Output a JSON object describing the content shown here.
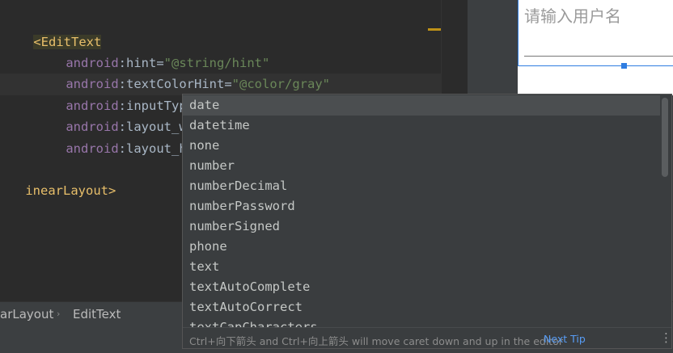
{
  "editor": {
    "lines": [
      {
        "tag": "<EditText"
      },
      {
        "ns": "android",
        "attr": "hint",
        "value": "\"@string/hint\""
      },
      {
        "ns": "android",
        "attr": "textColorHint",
        "value": "\"@color/gray\""
      },
      {
        "ns": "android",
        "attr": "inputType",
        "value_open": "\"",
        "value_close": "\""
      },
      {
        "ns": "android",
        "attr": "layout_wid"
      },
      {
        "ns": "android",
        "attr": "layout_hei"
      },
      {
        "tag": "inearLayout>"
      }
    ],
    "sep_colon": ":",
    "sep_equals": "="
  },
  "preview": {
    "hint_text": "请输入用户名"
  },
  "breadcrumb": {
    "items": [
      "arLayout",
      "EditText"
    ],
    "separator": "›"
  },
  "completion": {
    "items": [
      "date",
      "datetime",
      "none",
      "number",
      "numberDecimal",
      "numberPassword",
      "numberSigned",
      "phone",
      "text",
      "textAutoComplete",
      "textAutoCorrect",
      "textCapCharacters"
    ],
    "selected_index": 0,
    "footer_text": "Ctrl+向下箭头 and Ctrl+向上箭头 will move caret down and up in the editor",
    "next_tip_label": "Next Tip",
    "more_icon": "more-vertical-icon"
  },
  "colors": {
    "editor_bg": "#2b2b2b",
    "tag": "#e8bf6a",
    "attr_ns": "#9876aa",
    "string": "#6a8759",
    "accent_blue": "#2f7de1",
    "link": "#589df6"
  }
}
